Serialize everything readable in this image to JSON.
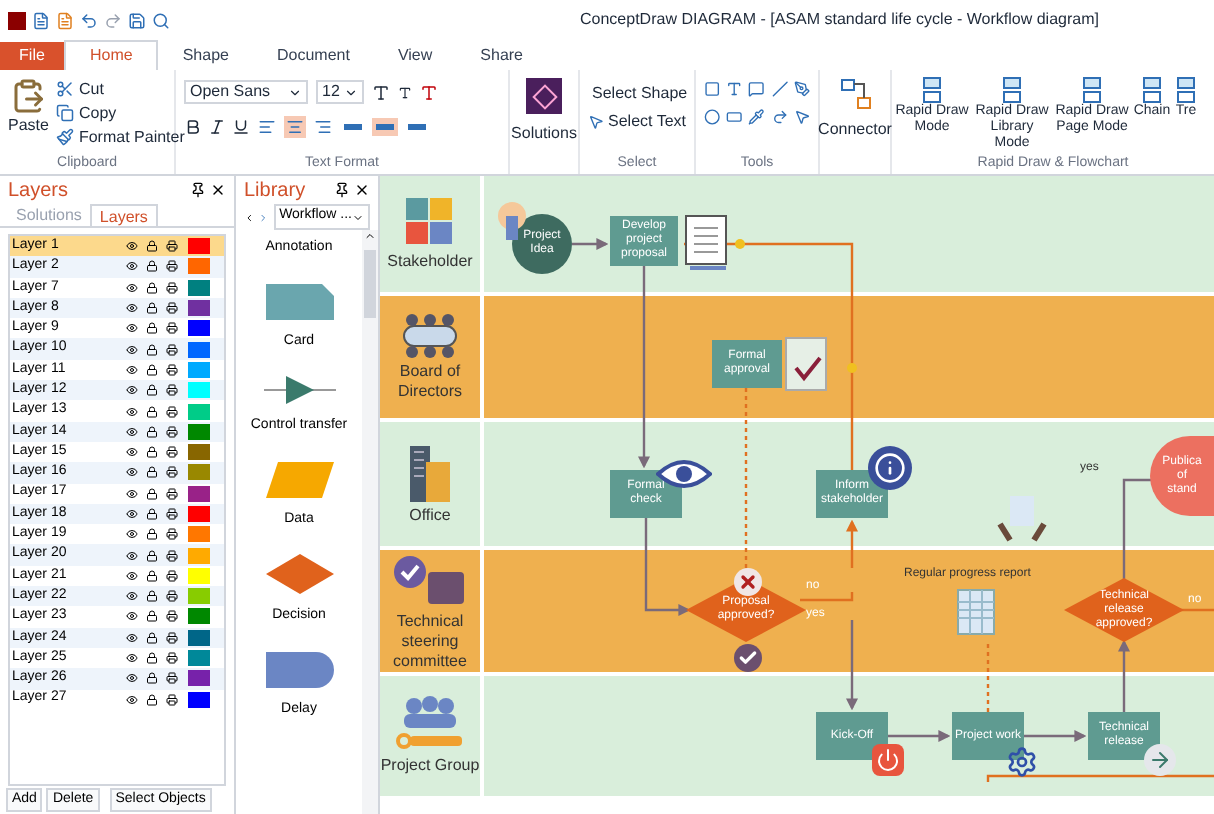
{
  "window": {
    "title": "ConceptDraw DIAGRAM - [ASAM standard life cycle - Workflow diagram]"
  },
  "menu_tabs": [
    {
      "label": "File",
      "kind": "file",
      "selected": false
    },
    {
      "label": "Home",
      "kind": "tab",
      "selected": true
    },
    {
      "label": "Shape",
      "kind": "tab",
      "selected": false
    },
    {
      "label": "Document",
      "kind": "tab",
      "selected": false
    },
    {
      "label": "View",
      "kind": "tab",
      "selected": false
    },
    {
      "label": "Share",
      "kind": "tab",
      "selected": false
    }
  ],
  "ribbon": {
    "clipboard": {
      "label": "Clipboard",
      "paste": "Paste",
      "items": [
        "Cut",
        "Copy",
        "Format Painter"
      ]
    },
    "text_format": {
      "label": "Text Format",
      "font": "Open Sans",
      "size": "12",
      "align": [
        {
          "selected": false
        },
        {
          "selected": true
        },
        {
          "selected": false
        }
      ],
      "valign": [
        {
          "selected": false
        },
        {
          "selected": true
        },
        {
          "selected": false
        }
      ]
    },
    "solutions": "Solutions",
    "select": {
      "label": "Select",
      "items": [
        "Select Shape",
        "Select Text"
      ]
    },
    "tools": {
      "label": "Tools"
    },
    "connector": "Connector",
    "rapid": {
      "label": "Rapid Draw & Flowchart",
      "items": [
        "Rapid Draw Mode",
        "Rapid Draw Library Mode",
        "Rapid Draw Page Mode",
        "Chain",
        "Tre"
      ]
    }
  },
  "layers_panel": {
    "title": "Layers",
    "tabs": [
      {
        "label": "Solutions",
        "selected": false
      },
      {
        "label": "Layers",
        "selected": true
      }
    ],
    "rows": [
      {
        "name": "Layer 1",
        "color": "#ff0000",
        "selected": true
      },
      {
        "name": "Layer 2",
        "color": "#ff6600",
        "selected": false
      },
      {
        "name": "Layer 7",
        "color": "#008080",
        "selected": false
      },
      {
        "name": "Layer 8",
        "color": "#7030a0",
        "selected": false
      },
      {
        "name": "Layer 9",
        "color": "#0000ff",
        "selected": false
      },
      {
        "name": "Layer 10",
        "color": "#0066ff",
        "selected": false
      },
      {
        "name": "Layer 11",
        "color": "#00aaff",
        "selected": false
      },
      {
        "name": "Layer 12",
        "color": "#00ffff",
        "selected": false
      },
      {
        "name": "Layer 13",
        "color": "#00cc88",
        "selected": false
      },
      {
        "name": "Layer 14",
        "color": "#008800",
        "selected": false
      },
      {
        "name": "Layer 15",
        "color": "#886600",
        "selected": false
      },
      {
        "name": "Layer 16",
        "color": "#998800",
        "selected": false
      },
      {
        "name": "Layer 17",
        "color": "#992288",
        "selected": false
      },
      {
        "name": "Layer 18",
        "color": "#ff0000",
        "selected": false
      },
      {
        "name": "Layer 19",
        "color": "#ff7700",
        "selected": false
      },
      {
        "name": "Layer 20",
        "color": "#ffaa00",
        "selected": false
      },
      {
        "name": "Layer 21",
        "color": "#ffff00",
        "selected": false
      },
      {
        "name": "Layer 22",
        "color": "#88cc00",
        "selected": false
      },
      {
        "name": "Layer 23",
        "color": "#008800",
        "selected": false
      },
      {
        "name": "Layer 24",
        "color": "#006688",
        "selected": false
      },
      {
        "name": "Layer 25",
        "color": "#008899",
        "selected": false
      },
      {
        "name": "Layer 26",
        "color": "#7722aa",
        "selected": false
      },
      {
        "name": "Layer 27",
        "color": "#0000ff",
        "selected": false
      }
    ],
    "buttons": [
      "Add",
      "Delete",
      "Select Objects"
    ]
  },
  "library": {
    "title": "Library",
    "dropdown": "Workflow ...",
    "items": [
      {
        "kind": "annotation",
        "label": "Annotation"
      },
      {
        "kind": "card",
        "label": "Card"
      },
      {
        "kind": "transfer",
        "label": "Control transfer"
      },
      {
        "kind": "data",
        "label": "Data"
      },
      {
        "kind": "decision",
        "label": "Decision"
      },
      {
        "kind": "delay",
        "label": "Delay"
      }
    ]
  },
  "diagram": {
    "lanes": [
      {
        "label": "Stakeholder",
        "kind": "light"
      },
      {
        "label": "Board of Directors",
        "kind": "dark"
      },
      {
        "label": "Office",
        "kind": "light"
      },
      {
        "label": "Technical steering committee",
        "kind": "dark"
      },
      {
        "label": "Project Group",
        "kind": "light"
      }
    ],
    "nodes": [
      {
        "kind": "circle",
        "label": "Project Idea"
      },
      {
        "kind": "process",
        "label": "Develop project proposal"
      },
      {
        "kind": "process",
        "label": "Formal approval"
      },
      {
        "kind": "process",
        "label": "Formal check"
      },
      {
        "kind": "process",
        "label": "Inform stakeholder"
      },
      {
        "kind": "decision",
        "label": "Proposal approved?"
      },
      {
        "kind": "decision",
        "label": "Technical release approved?"
      },
      {
        "kind": "process",
        "label": "Kick-Off"
      },
      {
        "kind": "process",
        "label": "Project work"
      },
      {
        "kind": "process",
        "label": "Technical release"
      },
      {
        "kind": "terminal",
        "label": "Publica of stand"
      }
    ],
    "notes": [
      {
        "kind": "title",
        "label": "Regular progress report"
      },
      {
        "kind": "edge",
        "label": "no"
      },
      {
        "kind": "edge",
        "label": "yes"
      },
      {
        "kind": "edge",
        "label": "no"
      },
      {
        "kind": "edge",
        "label": "yes"
      }
    ]
  }
}
